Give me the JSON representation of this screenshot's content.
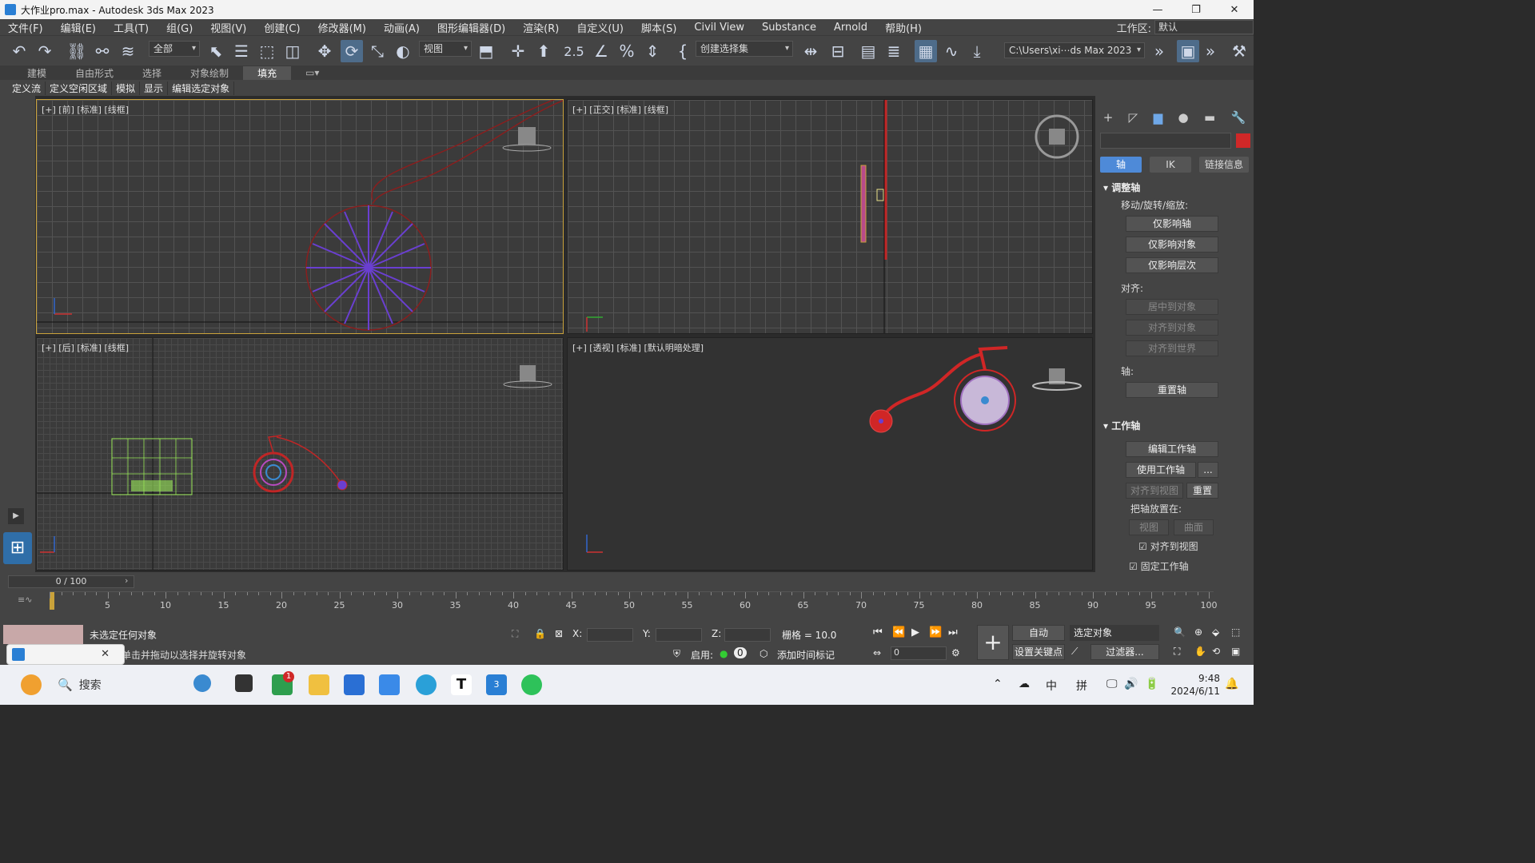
{
  "window": {
    "title": "大作业pro.max - Autodesk 3ds Max 2023",
    "controls": [
      "—",
      "❐",
      "✕"
    ]
  },
  "menu": {
    "items": [
      "文件(F)",
      "编辑(E)",
      "工具(T)",
      "组(G)",
      "视图(V)",
      "创建(C)",
      "修改器(M)",
      "动画(A)",
      "图形编辑器(D)",
      "渲染(R)",
      "自定义(U)",
      "脚本(S)",
      "Civil View",
      "Substance",
      "Arnold",
      "帮助(H)"
    ],
    "workspace_label": "工作区:",
    "workspace_value": "默认"
  },
  "toolbar": {
    "selection_filter": "全部",
    "ref_coord": "视图",
    "named_selection": "创建选择集",
    "snap_angle": "2.5",
    "path": "C:\\Users\\xi⋯ds Max 2023"
  },
  "ribbon": {
    "tabs": [
      "建模",
      "自由形式",
      "选择",
      "对象绘制",
      "填充"
    ],
    "active_tab": "填充",
    "buttons": [
      "定义流",
      "定义空闲区域",
      "模拟",
      "显示",
      "编辑选定对象"
    ]
  },
  "viewports": {
    "front": {
      "label": "[+] [前] [标准] [线框]"
    },
    "ortho": {
      "label": "[+] [正交] [标准] [线框]"
    },
    "back": {
      "label": "[+] [后] [标准] [线框]"
    },
    "persp": {
      "label": "[+] [透视] [标准] [默认明暗处理]"
    }
  },
  "command_panel": {
    "tabs": [
      "+",
      "◸",
      "▆",
      "●",
      "▬",
      "🔧"
    ],
    "sub_tabs": [
      "轴",
      "IK",
      "链接信息"
    ],
    "active_sub": "轴",
    "rollout_adjust": "调整轴",
    "move_label": "移动/旋转/缩放:",
    "affect_pivot": "仅影响轴",
    "affect_object": "仅影响对象",
    "affect_hierarchy": "仅影响层次",
    "align_label": "对齐:",
    "center_to_object": "居中到对象",
    "align_to_object": "对齐到对象",
    "align_to_world": "对齐到世界",
    "pivot_label": "轴:",
    "reset_pivot": "重置轴",
    "rollout_working": "工作轴",
    "edit_working": "编辑工作轴",
    "use_working": "使用工作轴",
    "ellipsis": "...",
    "align_to_view": "对齐到视图",
    "reset": "重置",
    "place_pivot": "把轴放置在:",
    "view": "视图",
    "surface": "曲面",
    "align_view_check": "对齐到视图",
    "lock_working": "固定工作轴"
  },
  "timeline": {
    "frame": "0 / 100",
    "ticks": [
      "5",
      "10",
      "15",
      "20",
      "25",
      "30",
      "35",
      "40",
      "45",
      "50",
      "55",
      "60",
      "65",
      "70",
      "75",
      "80",
      "85",
      "90",
      "95",
      "100"
    ]
  },
  "status": {
    "selection": "未选定任何对象",
    "prompt": "单击并拖动以选择并旋转对象",
    "x_label": "X:",
    "y_label": "Y:",
    "z_label": "Z:",
    "grid": "栅格 = 10.0",
    "enable_label": "启用:",
    "enable_value": "0",
    "add_time_tag": "添加时间标记",
    "auto_key": "自动",
    "selected_objects": "选定对象",
    "set_key": "设置关键点",
    "filters": "过滤器...",
    "frame_value": "0"
  },
  "taskbar": {
    "search": "搜索",
    "badge": "1",
    "ime_zh": "中",
    "ime_pin": "拼",
    "time": "9:48",
    "date": "2024/6/11"
  },
  "colors": {
    "accent": "#4e8ad8",
    "object_red": "#c02626",
    "spoke_purple": "#6a3fd0"
  }
}
